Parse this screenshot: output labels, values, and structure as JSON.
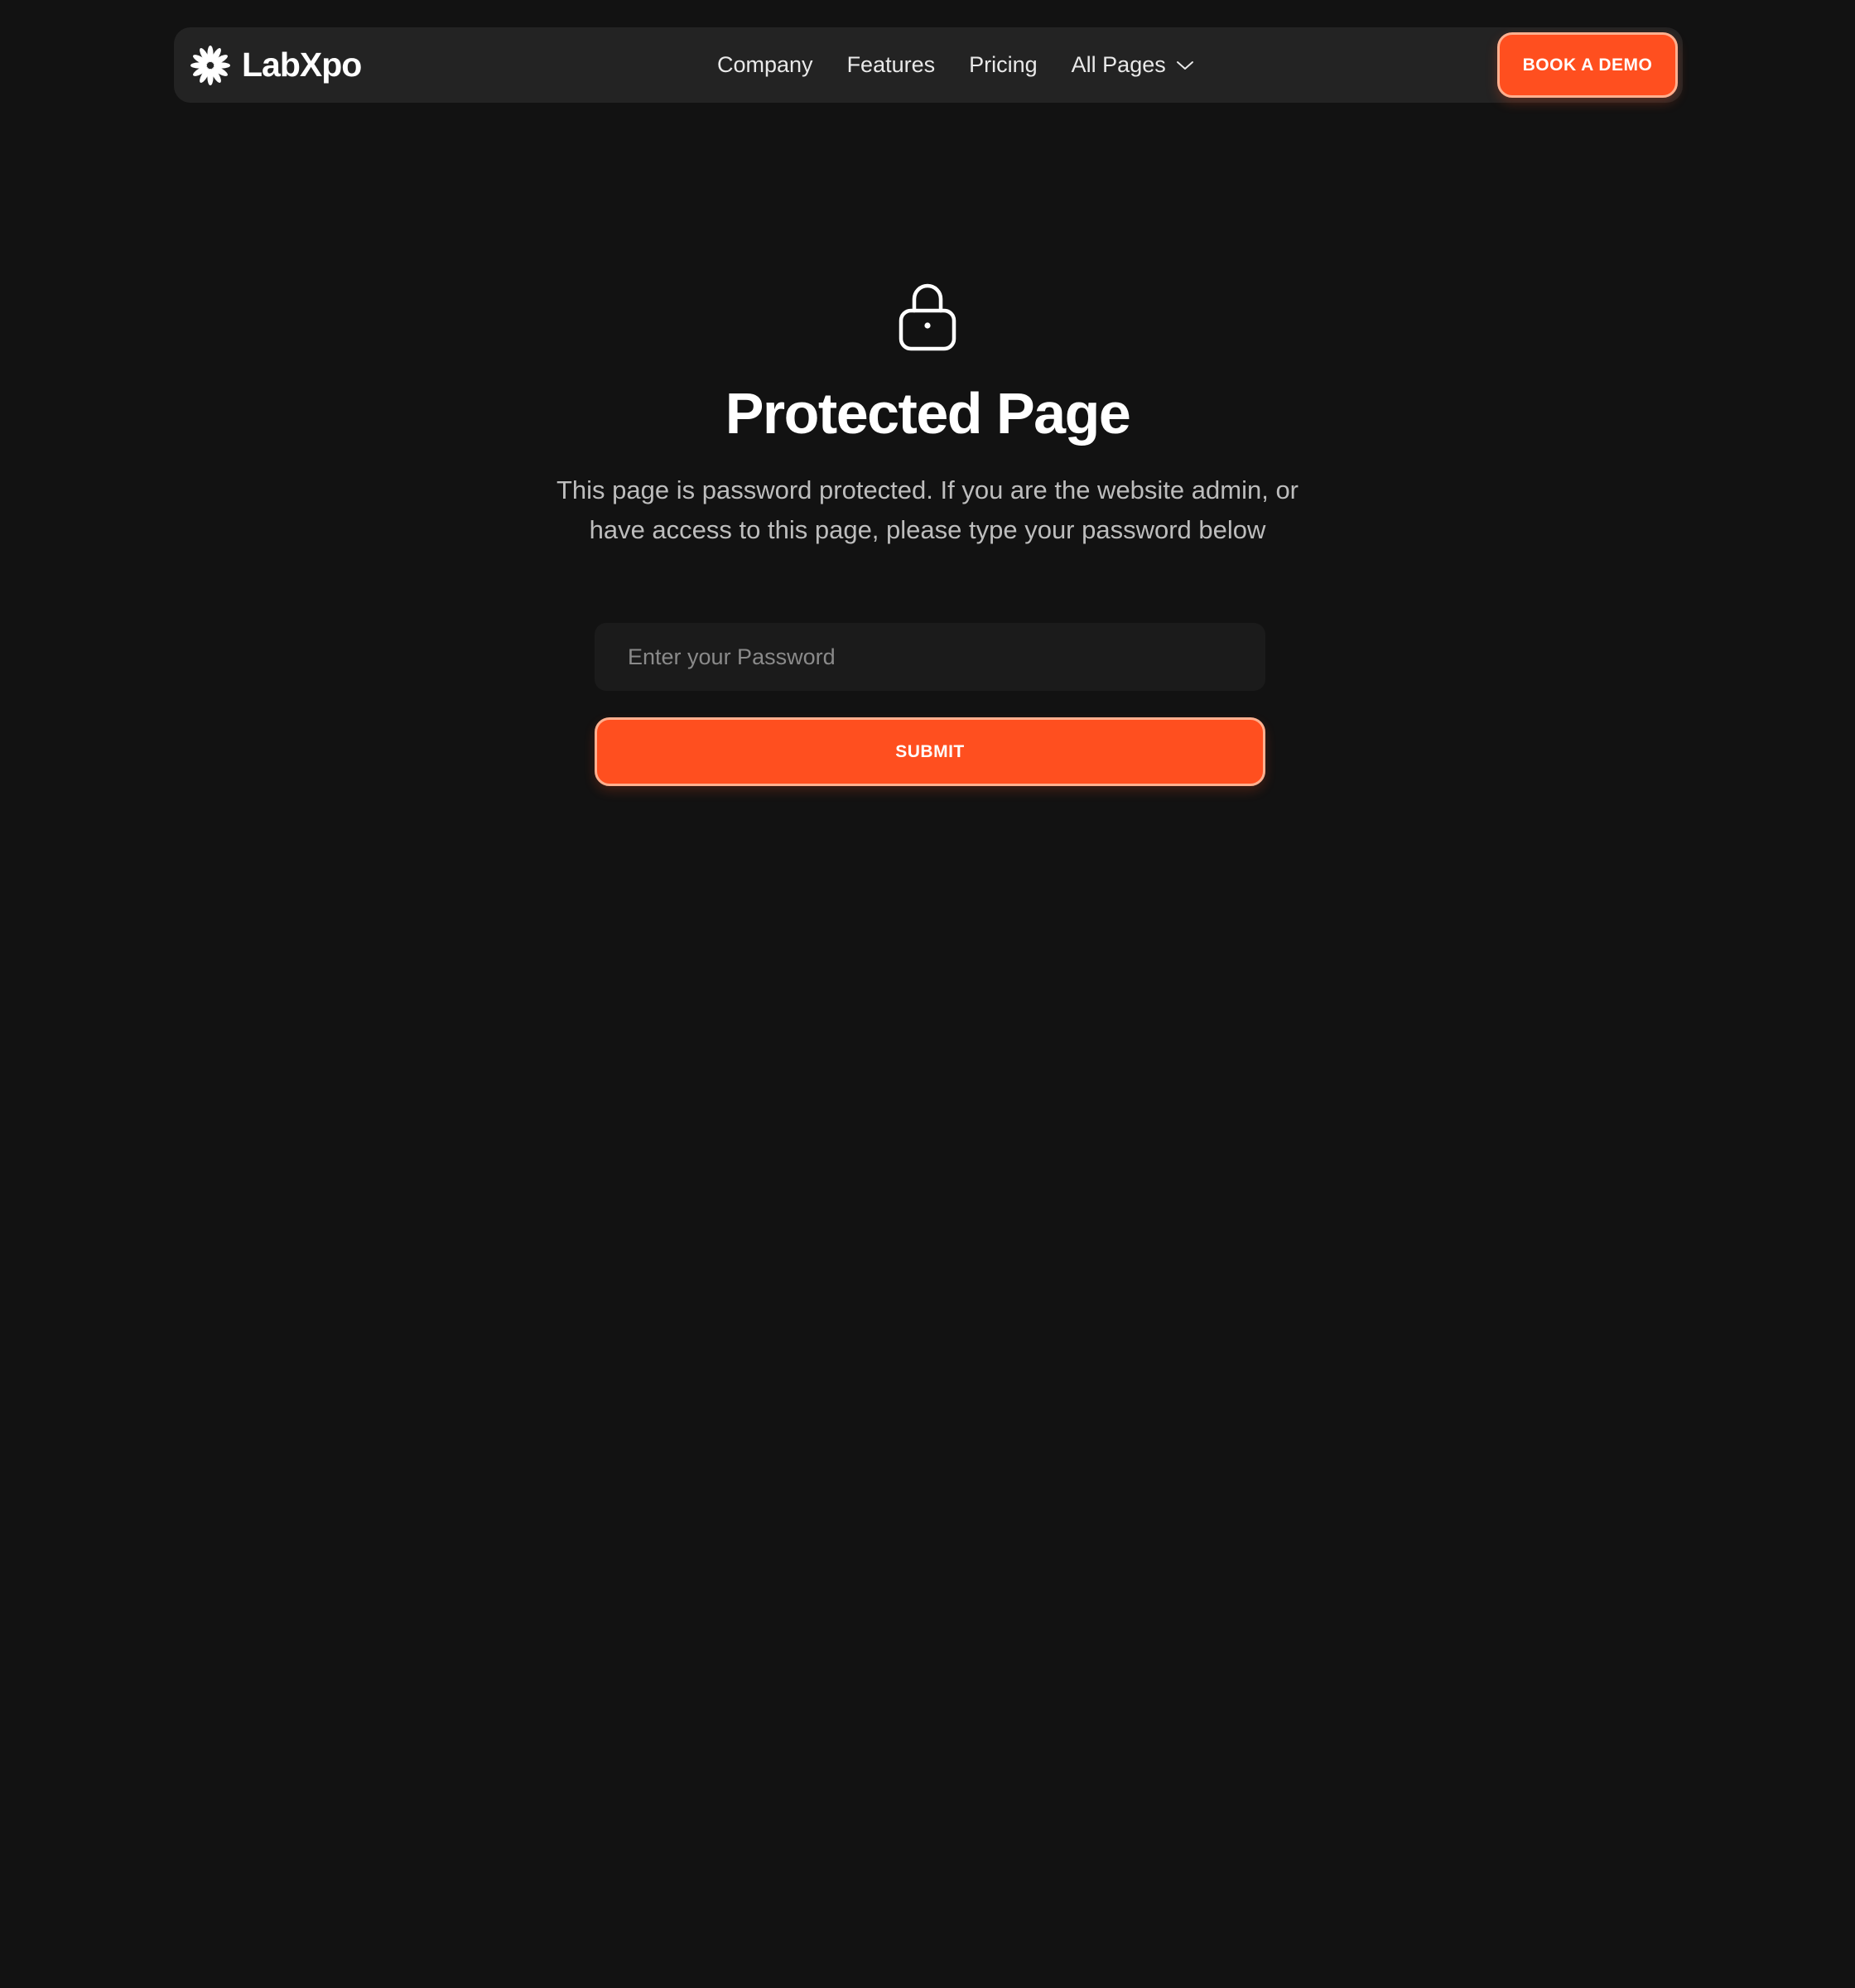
{
  "header": {
    "brand_name": "LabXpo",
    "brand_icon": "asterisk-flower-icon",
    "nav": [
      {
        "label": "Company"
      },
      {
        "label": "Features"
      },
      {
        "label": "Pricing"
      },
      {
        "label": "All Pages",
        "icon": "chevron-down-icon"
      }
    ],
    "cta_label": "BOOK A DEMO"
  },
  "main": {
    "icon": "lock-icon",
    "title": "Protected Page",
    "description": "This page is password protected. If you are the website admin, or have access to this page, please type your password below",
    "password_placeholder": "Enter your Password",
    "password_value": "",
    "submit_label": "SUBMIT"
  },
  "colors": {
    "background": "#121212",
    "nav_background": "#232323",
    "accent": "#ff4f1f",
    "accent_border": "#ffb08f",
    "input_background": "#1b1b1b"
  }
}
